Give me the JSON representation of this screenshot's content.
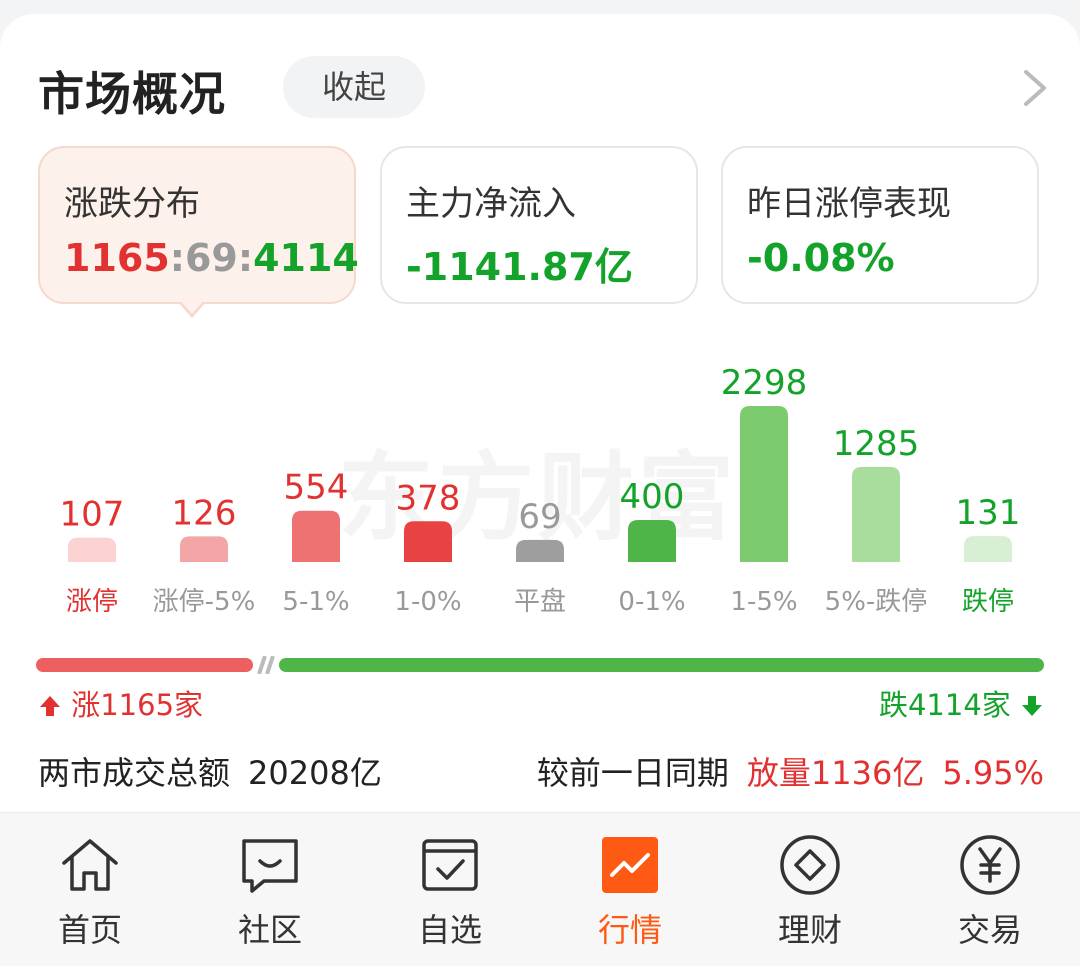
{
  "header": {
    "title": "市场概况",
    "collapse_label": "收起"
  },
  "tiles": [
    {
      "label": "涨跌分布",
      "up": "1165",
      "sep1": ":",
      "flat": "69",
      "sep2": ":",
      "down": "4114"
    },
    {
      "label": "主力净流入",
      "value": "-1141.87亿"
    },
    {
      "label": "昨日涨停表现",
      "value": "-0.08%"
    }
  ],
  "watermark": "东方财富",
  "chart_data": {
    "type": "bar",
    "categories": [
      "涨停",
      "涨停-5%",
      "5-1%",
      "1-0%",
      "平盘",
      "0-1%",
      "1-5%",
      "5%-跌停",
      "跌停"
    ],
    "values": [
      107,
      126,
      554,
      378,
      69,
      400,
      2298,
      1285,
      131
    ],
    "colors": [
      "#fbd3d3",
      "#f4a6a6",
      "#ee7272",
      "#e84242",
      "#9e9e9e",
      "#4fb548",
      "#7ccb6f",
      "#a9dd9e",
      "#d7efd2"
    ],
    "label_colors": [
      "#e23131",
      "#e23131",
      "#e23131",
      "#e23131",
      "#999999",
      "#14a32a",
      "#14a32a",
      "#14a32a",
      "#14a32a"
    ],
    "category_colors": [
      "#e23131",
      "#999999",
      "#999999",
      "#999999",
      "#999999",
      "#999999",
      "#999999",
      "#999999",
      "#14a32a"
    ]
  },
  "breadth": {
    "up_count": 1165,
    "down_count": 4114,
    "up_label": "涨1165家",
    "down_label": "跌4114家"
  },
  "summary": {
    "turnover_label": "两市成交总额",
    "turnover_value": "20208亿",
    "compare_label": "较前一日同期",
    "compare_change": "放量1136亿",
    "compare_pct": "5.95%"
  },
  "colors": {
    "up": "#e23131",
    "down": "#14a32a",
    "accent": "#ff5a14"
  },
  "tabbar": [
    {
      "label": "首页",
      "icon": "home-icon"
    },
    {
      "label": "社区",
      "icon": "chat-icon"
    },
    {
      "label": "自选",
      "icon": "watchlist-icon"
    },
    {
      "label": "行情",
      "icon": "market-chart-icon",
      "active": true
    },
    {
      "label": "理财",
      "icon": "diamond-icon"
    },
    {
      "label": "交易",
      "icon": "yen-icon"
    }
  ]
}
